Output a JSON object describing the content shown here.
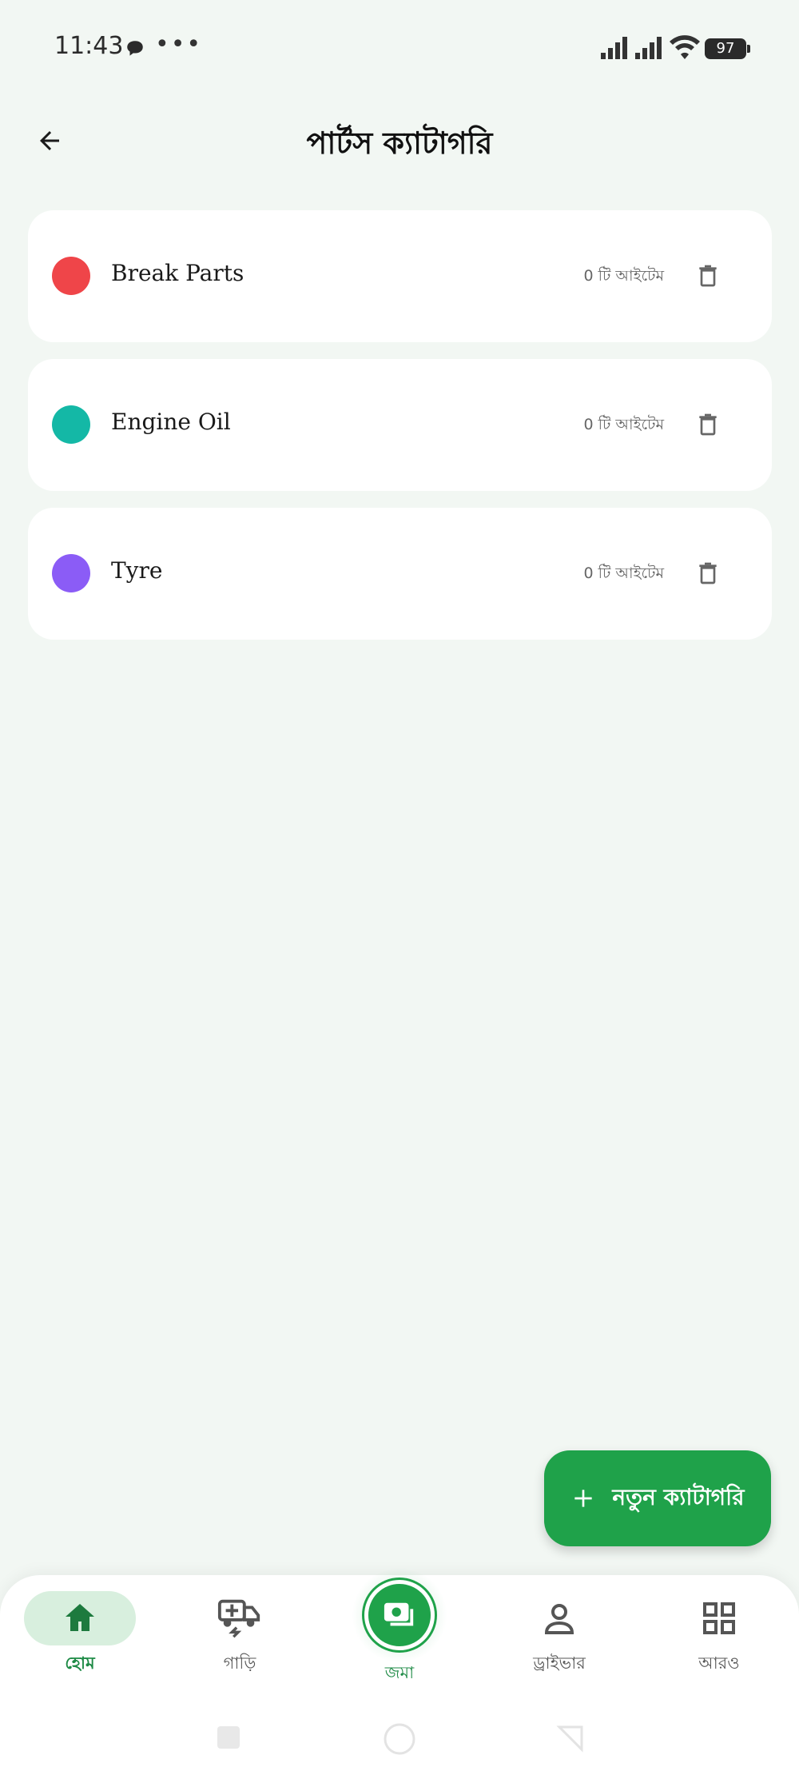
{
  "status_bar": {
    "time": "11:43",
    "dots": "•••",
    "battery": "97"
  },
  "header": {
    "title": "পার্টস ক্যাটাগরি"
  },
  "categories": [
    {
      "name": "Break Parts",
      "count_label": "0 টি আইটেম",
      "color": "#ef4549"
    },
    {
      "name": "Engine Oil",
      "count_label": "0 টি আইটেম",
      "color": "#14b8a6"
    },
    {
      "name": "Tyre",
      "count_label": "0 টি আইটেম",
      "color": "#8b5cf6"
    }
  ],
  "fab": {
    "label": "নতুন ক্যাটাগরি"
  },
  "bottom_nav": {
    "home": "হোম",
    "vehicles": "গাড়ি",
    "deposit": "জমা",
    "driver": "ড্রাইভার",
    "more": "আরও"
  },
  "colors": {
    "accent": "#1fa24a",
    "background": "#f2f7f3"
  }
}
